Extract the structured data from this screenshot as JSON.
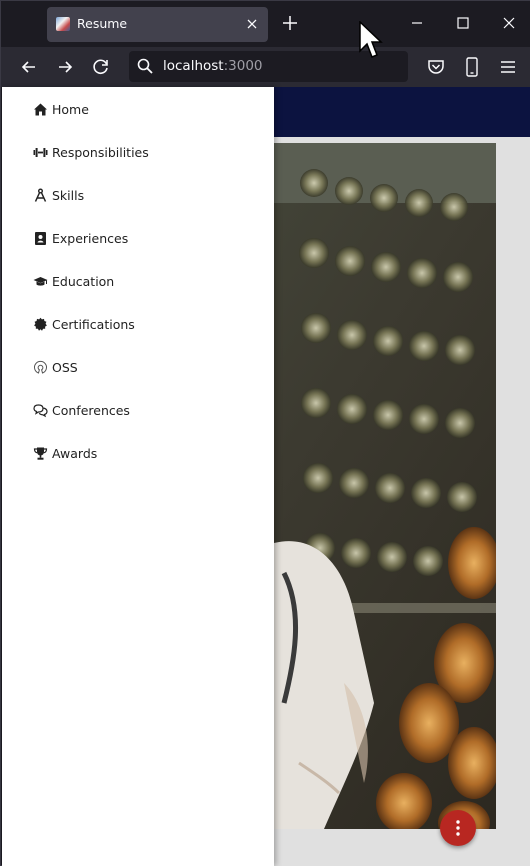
{
  "browser": {
    "tab_title": "Resume",
    "url_host": "localhost",
    "url_port": ":3000"
  },
  "drawer": {
    "items": [
      {
        "label": "Home",
        "icon": "home-icon"
      },
      {
        "label": "Responsibilities",
        "icon": "dumbbell-icon"
      },
      {
        "label": "Skills",
        "icon": "compass-icon"
      },
      {
        "label": "Experiences",
        "icon": "contact-card-icon"
      },
      {
        "label": "Education",
        "icon": "graduation-cap-icon"
      },
      {
        "label": "Certifications",
        "icon": "certificate-icon"
      },
      {
        "label": "OSS",
        "icon": "open-source-icon"
      },
      {
        "label": "Conferences",
        "icon": "comments-icon"
      },
      {
        "label": "Awards",
        "icon": "trophy-icon"
      }
    ]
  },
  "colors": {
    "appbar": "#0c1340",
    "fab": "#b82721",
    "browser_bg": "#1c1b22",
    "navbar_bg": "#2b2a33"
  }
}
